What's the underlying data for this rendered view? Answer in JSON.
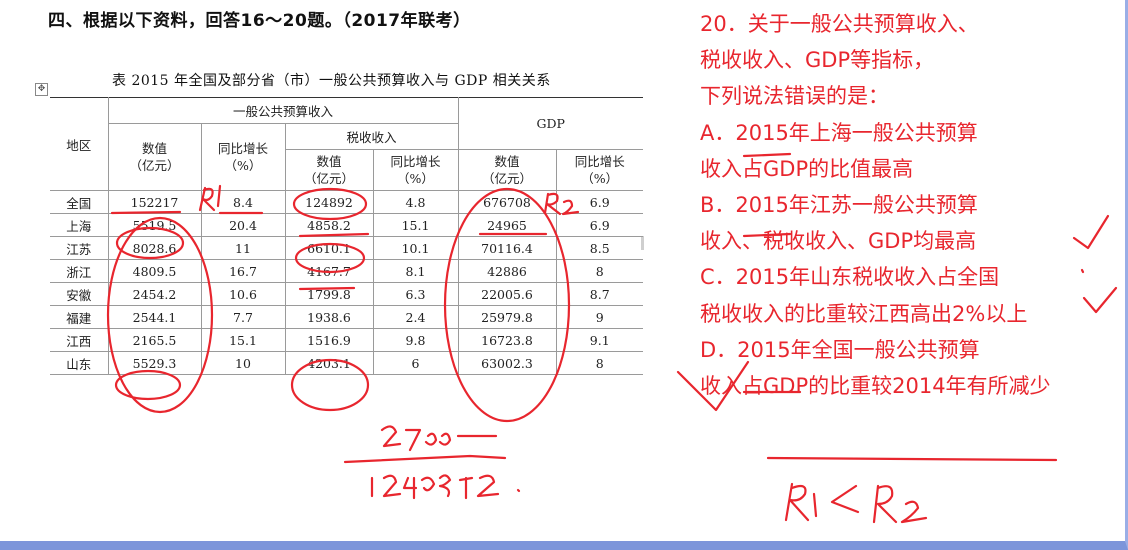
{
  "heading": "四、根据以下资料，回答16～20题。（2017年联考）",
  "table": {
    "caption": "表 2015 年全国及部分省（市）一般公共预算收入与 GDP 相关关系",
    "headers": {
      "region": "地区",
      "budget_group": "一般公共预算收入",
      "tax_group": "税收收入",
      "gdp_group": "GDP",
      "value": "数值",
      "value_unit": "（亿元）",
      "growth": "同比增长",
      "growth_unit": "（%）"
    },
    "rows": [
      {
        "region": "全国",
        "budget": "152217",
        "budget_growth": "8.4",
        "tax": "124892",
        "tax_growth": "4.8",
        "gdp": "676708",
        "gdp_growth": "6.9"
      },
      {
        "region": "上海",
        "budget": "5519.5",
        "budget_growth": "20.4",
        "tax": "4858.2",
        "tax_growth": "15.1",
        "gdp": "24965",
        "gdp_growth": "6.9"
      },
      {
        "region": "江苏",
        "budget": "8028.6",
        "budget_growth": "11",
        "tax": "6610.1",
        "tax_growth": "10.1",
        "gdp": "70116.4",
        "gdp_growth": "8.5"
      },
      {
        "region": "浙江",
        "budget": "4809.5",
        "budget_growth": "16.7",
        "tax": "4167.7",
        "tax_growth": "8.1",
        "gdp": "42886",
        "gdp_growth": "8"
      },
      {
        "region": "安徽",
        "budget": "2454.2",
        "budget_growth": "10.6",
        "tax": "1799.8",
        "tax_growth": "6.3",
        "gdp": "22005.6",
        "gdp_growth": "8.7"
      },
      {
        "region": "福建",
        "budget": "2544.1",
        "budget_growth": "7.7",
        "tax": "1938.6",
        "tax_growth": "2.4",
        "gdp": "25979.8",
        "gdp_growth": "9"
      },
      {
        "region": "江西",
        "budget": "2165.5",
        "budget_growth": "15.1",
        "tax": "1516.9",
        "tax_growth": "9.8",
        "gdp": "16723.8",
        "gdp_growth": "9.1"
      },
      {
        "region": "山东",
        "budget": "5529.3",
        "budget_growth": "10",
        "tax": "4203.1",
        "tax_growth": "6",
        "gdp": "63002.3",
        "gdp_growth": "8"
      }
    ]
  },
  "question": {
    "lines": [
      "20．关于一般公共预算收入、",
      "税收收入、GDP等指标，",
      "下列说法错误的是：",
      "A．2015年上海一般公共预算",
      "收入占GDP的比值最高",
      "B．2015年江苏一般公共预算",
      "收入、税收收入、GDP均最高",
      "C．2015年山东税收收入占全国",
      "税收收入的比重较江西高出2%以上",
      "D．2015年全国一般公共预算",
      "收入占GDP的比重较2014年有所减少"
    ]
  },
  "annotations": {
    "r1": "R1",
    "r2": "R2",
    "calc_top": "2700",
    "calc_bottom": "124892",
    "compare": "R1 < R2"
  },
  "colors": {
    "ink": "#e8262e",
    "frame": "#7d95da"
  }
}
